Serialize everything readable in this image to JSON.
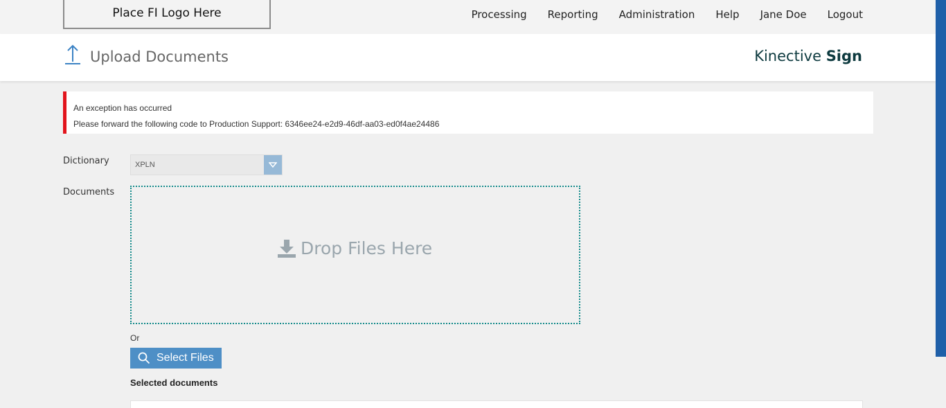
{
  "topbar": {
    "logo_text": "Place FI Logo Here",
    "nav": [
      "Processing",
      "Reporting",
      "Administration",
      "Help",
      "Jane Doe",
      "Logout"
    ]
  },
  "header": {
    "title": "Upload Documents",
    "brand_light": "Kinective",
    "brand_bold": "Sign",
    "icon": "upload-arrow-icon"
  },
  "alert": {
    "line1": "An exception has occurred",
    "line2": "Please forward the following code to Production Support: 6346ee24-e2d9-46df-aa03-ed0f4ae24486",
    "color": "#e2141c"
  },
  "form": {
    "dictionary_label": "Dictionary",
    "dictionary_value": "XPLN",
    "documents_label": "Documents",
    "drop_text": "Drop Files Here",
    "or_text": "Or",
    "select_button": "Select Files",
    "selected_heading": "Selected documents"
  },
  "colors": {
    "accent_blue": "#4e8fc6",
    "dropzone_border": "#138a8a",
    "brand": "#0d3a3f"
  }
}
